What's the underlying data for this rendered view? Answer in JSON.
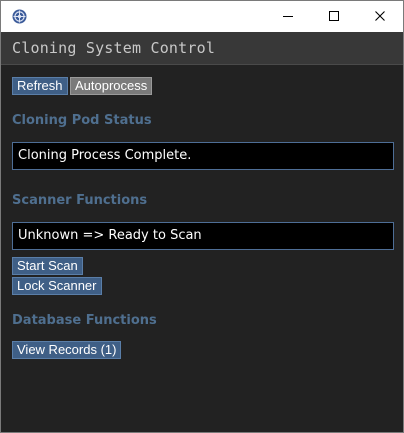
{
  "window": {
    "title_bar_icon": "gear-emblem-icon",
    "controls": {
      "minimize_icon": "minimize-icon",
      "maximize_icon": "maximize-icon",
      "close_icon": "close-icon"
    }
  },
  "app": {
    "title": "Cloning System Control"
  },
  "toolbar": {
    "refresh_label": "Refresh",
    "autoprocess_label": "Autoprocess"
  },
  "pod_status": {
    "heading": "Cloning Pod Status",
    "status_text": "Cloning Process Complete."
  },
  "scanner": {
    "heading": "Scanner Functions",
    "status_text": "Unknown => Ready to Scan",
    "start_scan_label": "Start Scan",
    "lock_scanner_label": "Lock Scanner"
  },
  "database": {
    "heading": "Database Functions",
    "view_records_label": "View Records (1)"
  },
  "colors": {
    "background": "#222222",
    "header_bar": "#383838",
    "button": "#3f5f86",
    "button_alt": "#7a7a7a",
    "heading": "#4f6f8f",
    "status_border": "#4e6e96"
  }
}
